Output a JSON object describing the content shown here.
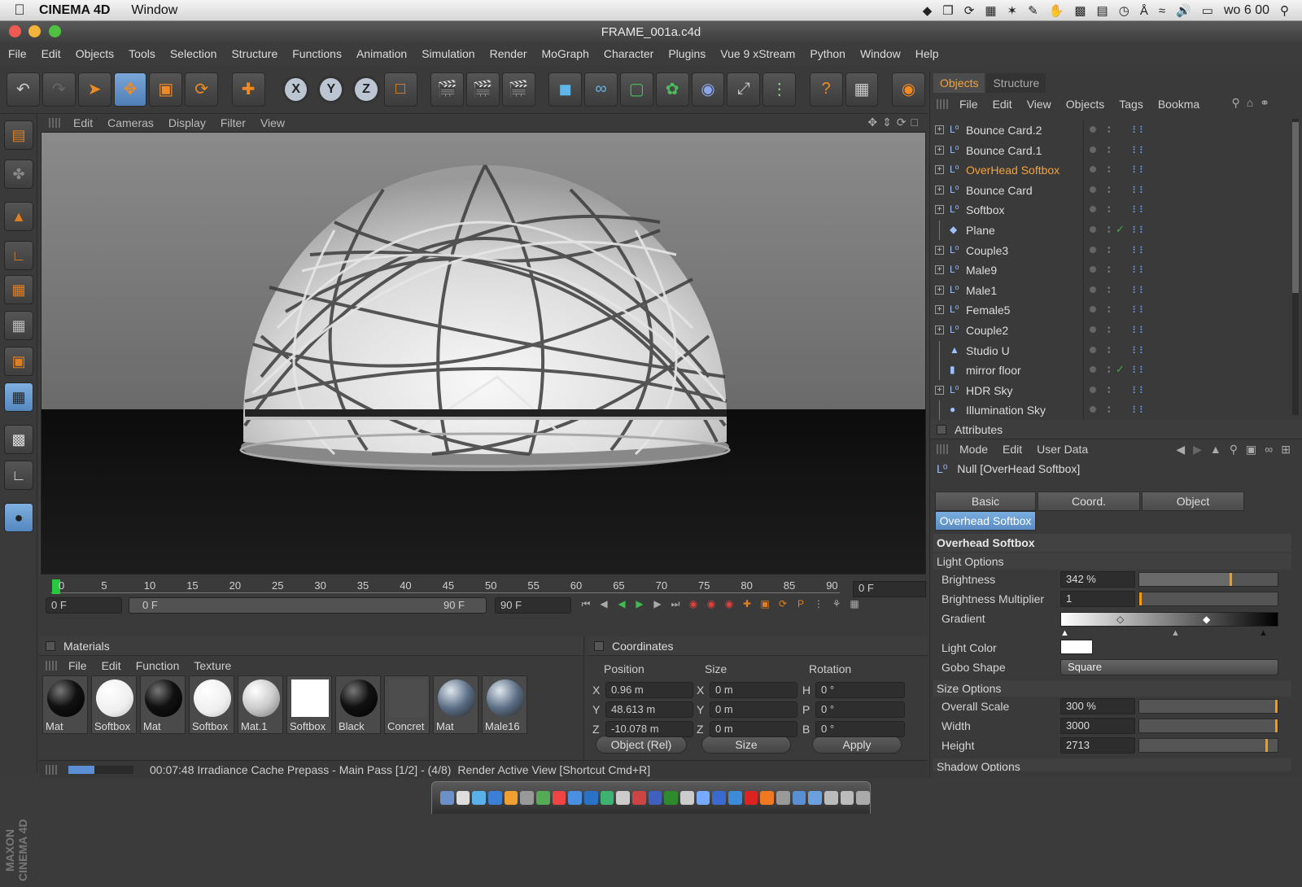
{
  "mac": {
    "app": "CINEMA 4D",
    "menu": "Window",
    "clock": "wo 6 00",
    "apple_icon": "apple-icon"
  },
  "window": {
    "title": "FRAME_001a.c4d"
  },
  "menubar": [
    "File",
    "Edit",
    "Objects",
    "Tools",
    "Selection",
    "Structure",
    "Functions",
    "Animation",
    "Simulation",
    "Render",
    "MoGraph",
    "Character",
    "Plugins",
    "Vue 9 xStream",
    "Python",
    "Window",
    "Help"
  ],
  "viewport": {
    "menu": [
      "Edit",
      "Cameras",
      "Display",
      "Filter",
      "View"
    ]
  },
  "timeline": {
    "ticks": [
      "0",
      "5",
      "10",
      "15",
      "20",
      "25",
      "30",
      "35",
      "40",
      "45",
      "50",
      "55",
      "60",
      "65",
      "70",
      "75",
      "80",
      "85",
      "90"
    ],
    "current_frame": "0 F",
    "start_frame": "0 F",
    "range_start": "0 F",
    "range_end": "90 F",
    "end_frame": "90 F"
  },
  "materials": {
    "title": "Materials",
    "menu": [
      "File",
      "Edit",
      "Function",
      "Texture"
    ],
    "items": [
      {
        "name": "Mat",
        "style": "black"
      },
      {
        "name": "Softbox",
        "style": "white"
      },
      {
        "name": "Mat",
        "style": "black"
      },
      {
        "name": "Softbox",
        "style": "white"
      },
      {
        "name": "Mat.1",
        "style": "grey"
      },
      {
        "name": "Softbox",
        "style": "square"
      },
      {
        "name": "Black",
        "style": "black"
      },
      {
        "name": "Concret",
        "style": "concrete"
      },
      {
        "name": "Mat",
        "style": "hdr"
      },
      {
        "name": "Male16",
        "style": "hdr"
      }
    ]
  },
  "coordinates": {
    "title": "Coordinates",
    "headers": [
      "Position",
      "Size",
      "Rotation"
    ],
    "rows": [
      {
        "axis": "X",
        "pos": "0.96 m",
        "size_axis": "X",
        "size": "0 m",
        "rot_axis": "H",
        "rot": "0 °"
      },
      {
        "axis": "Y",
        "pos": "48.613 m",
        "size_axis": "Y",
        "size": "0 m",
        "rot_axis": "P",
        "rot": "0 °"
      },
      {
        "axis": "Z",
        "pos": "-10.078 m",
        "size_axis": "Z",
        "size": "0 m",
        "rot_axis": "B",
        "rot": "0 °"
      }
    ],
    "mode": "Object (Rel)",
    "size_mode": "Size",
    "apply": "Apply"
  },
  "status": {
    "text": "00:07:48 Irradiance Cache Prepass - Main Pass [1/2] - (4/8)",
    "hint": "Render Active View [Shortcut Cmd+R]",
    "progress": 0.4
  },
  "objects": {
    "tabs": [
      "Objects",
      "Structure"
    ],
    "menu": [
      "File",
      "Edit",
      "View",
      "Objects",
      "Tags",
      "Bookma"
    ],
    "items": [
      {
        "name": "Bounce Card.2",
        "icon": "null",
        "exp": "+"
      },
      {
        "name": "Bounce Card.1",
        "icon": "null",
        "exp": "+"
      },
      {
        "name": "OverHead Softbox",
        "icon": "null",
        "exp": "+",
        "selected": true
      },
      {
        "name": "Bounce Card",
        "icon": "null",
        "exp": "+"
      },
      {
        "name": "Softbox",
        "icon": "null",
        "exp": "+"
      },
      {
        "name": "Plane",
        "icon": "plane",
        "exp": "",
        "check": true
      },
      {
        "name": "Couple3",
        "icon": "null",
        "exp": "+"
      },
      {
        "name": "Male9",
        "icon": "null",
        "exp": "+"
      },
      {
        "name": "Male1",
        "icon": "null",
        "exp": "+"
      },
      {
        "name": "Female5",
        "icon": "null",
        "exp": "+"
      },
      {
        "name": "Couple2",
        "icon": "null",
        "exp": "+"
      },
      {
        "name": "Studio U",
        "icon": "light",
        "exp": ""
      },
      {
        "name": "mirror floor",
        "icon": "floor",
        "exp": "",
        "check": true
      },
      {
        "name": "HDR Sky",
        "icon": "null",
        "exp": "+"
      },
      {
        "name": "Illumination Sky",
        "icon": "sky",
        "exp": ""
      }
    ]
  },
  "attributes": {
    "title": "Attributes",
    "menu": [
      "Mode",
      "Edit",
      "User Data"
    ],
    "object": "Null [OverHead Softbox]",
    "tabs": [
      "Basic",
      "Coord.",
      "Object"
    ],
    "active_tab": "Overhead Softbox",
    "section": "Overhead Softbox",
    "light_options": "Light Options",
    "brightness_label": "Brightness",
    "brightness": "342 %",
    "brightness_level": 0.65,
    "multiplier_label": "Brightness Multiplier",
    "multiplier": "1",
    "gradient_label": "Gradient",
    "light_color_label": "Light Color",
    "gobo_label": "Gobo Shape",
    "gobo": "Square",
    "size_options": "Size Options",
    "overall_label": "Overall Scale",
    "overall": "300 %",
    "width_label": "Width",
    "width": "3000",
    "height_label": "Height",
    "height": "2713",
    "shadow_options": "Shadow Options"
  }
}
